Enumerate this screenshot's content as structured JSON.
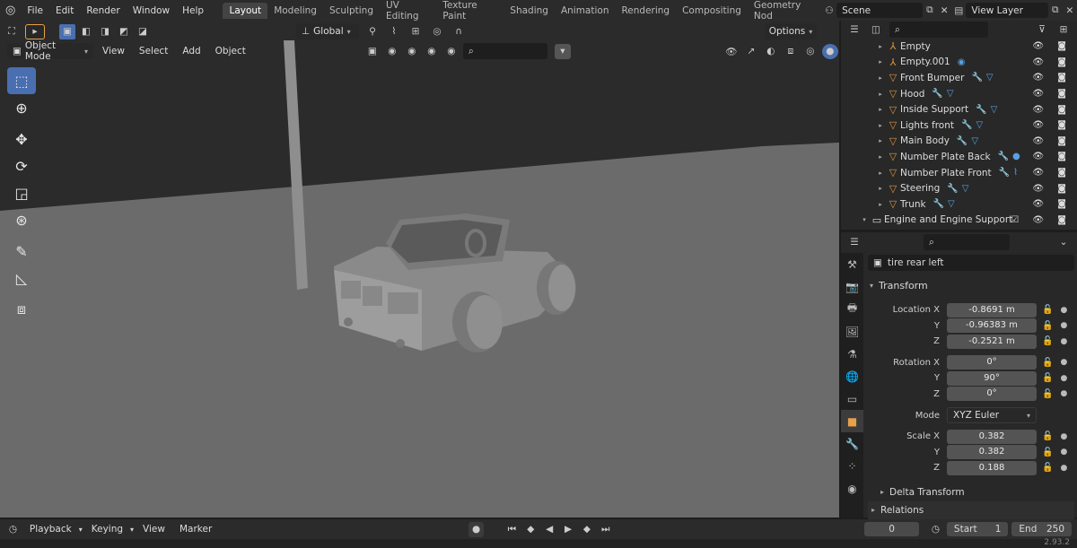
{
  "topbar": {
    "menus": [
      "File",
      "Edit",
      "Render",
      "Window",
      "Help"
    ],
    "workspaces": [
      "Layout",
      "Modeling",
      "Sculpting",
      "UV Editing",
      "Texture Paint",
      "Shading",
      "Animation",
      "Rendering",
      "Compositing",
      "Geometry Nod"
    ],
    "active_workspace": "Layout",
    "scene": "Scene",
    "view_layer": "View Layer"
  },
  "viewport": {
    "mode": "Object Mode",
    "menus": [
      "View",
      "Select",
      "Add",
      "Object"
    ],
    "orientation": "Global",
    "options_label": "Options"
  },
  "outliner": {
    "items": [
      {
        "label": "Empty",
        "type": "empty",
        "mods": ""
      },
      {
        "label": "Empty.001",
        "type": "empty",
        "mods": "◉"
      },
      {
        "label": "Front Bumper",
        "type": "mesh",
        "mods": "🔧▽"
      },
      {
        "label": "Hood",
        "type": "mesh",
        "mods": "🔧▽"
      },
      {
        "label": "Inside Support",
        "type": "mesh",
        "mods": "🔧▽"
      },
      {
        "label": "Lights front",
        "type": "mesh",
        "mods": "🔧▽"
      },
      {
        "label": "Main Body",
        "type": "mesh",
        "mods": "🔧▽"
      },
      {
        "label": "Number Plate Back",
        "type": "mesh",
        "mods": "🔧●"
      },
      {
        "label": "Number Plate Front",
        "type": "mesh",
        "mods": "🔧⌇"
      },
      {
        "label": "Steering",
        "type": "mesh",
        "mods": "🔧▽"
      },
      {
        "label": "Trunk",
        "type": "mesh",
        "mods": "🔧▽"
      }
    ],
    "collection": "Engine and Engine Support"
  },
  "properties": {
    "object_name": "tire rear left",
    "transform_header": "Transform",
    "location_label": "Location X",
    "location": [
      "-0.8691 m",
      "-0.96383 m",
      "-0.2521 m"
    ],
    "rotation_label": "Rotation X",
    "rotation": [
      "0°",
      "90°",
      "0°"
    ],
    "mode_label": "Mode",
    "mode_value": "XYZ Euler",
    "scale_label": "Scale X",
    "scale": [
      "0.382",
      "0.382",
      "0.188"
    ],
    "axis_y": "Y",
    "axis_z": "Z",
    "delta": "Delta Transform",
    "relations": "Relations"
  },
  "timeline": {
    "menus": [
      "Playback",
      "Keying",
      "View",
      "Marker"
    ],
    "current_frame": "0",
    "start_label": "Start",
    "start": "1",
    "end_label": "End",
    "end": "250"
  },
  "status": {
    "version": "2.93.2"
  }
}
